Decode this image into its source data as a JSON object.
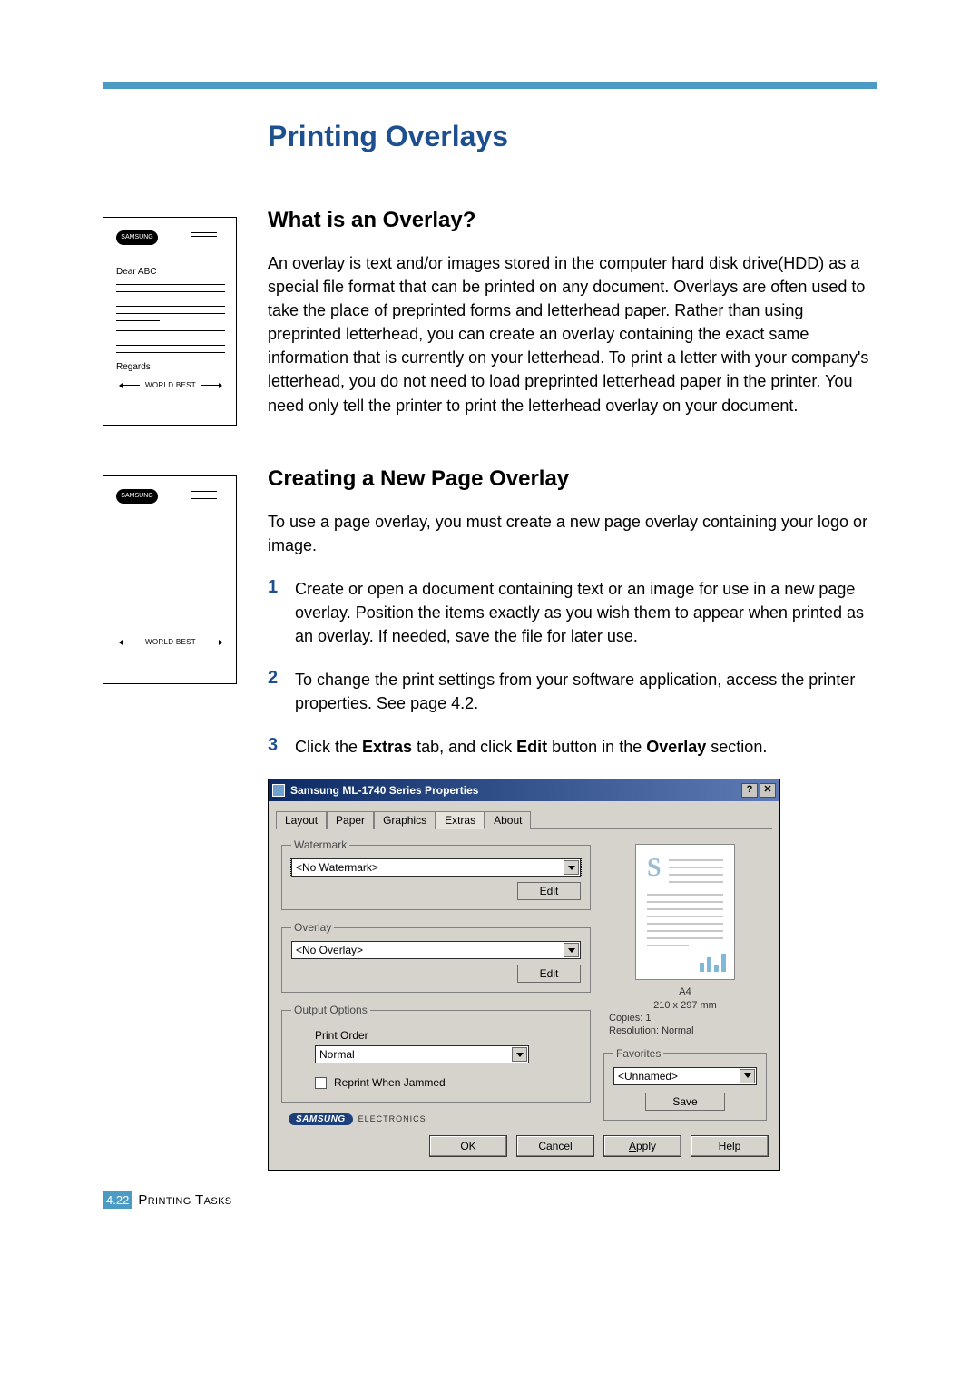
{
  "page_title": "Printing Overlays",
  "section1": {
    "heading": "What is an Overlay?",
    "text": "An overlay is text and/or images stored in the computer hard disk drive(HDD) as a special file format that can be printed on any document. Overlays are often used to take the place of preprinted forms and letterhead paper. Rather than using preprinted letterhead, you can create an overlay containing the exact same information that is currently on your letterhead. To print a letter with your company's letterhead, you do not need to load preprinted letterhead paper in the printer. You need only tell the printer to print the letterhead overlay on your document."
  },
  "section2": {
    "heading": "Creating a New Page Overlay",
    "intro": "To use a page overlay, you must create a new page overlay containing your logo or image.",
    "steps": [
      {
        "num": "1",
        "text": "Create or open a document containing text or an image for use in a new page overlay. Position the items exactly as you wish them to appear when printed as an overlay. If needed, save the file for later use."
      },
      {
        "num": "2",
        "text": "To change the print settings from your software application, access the printer properties. See page 4.2."
      },
      {
        "num": "3",
        "text_prefix": "Click the ",
        "b1": "Extras",
        "mid1": " tab, and click ",
        "b2": "Edit",
        "mid2": " button in the ",
        "b3": "Overlay",
        "suffix": " section."
      }
    ]
  },
  "letter": {
    "logo": "SAMSUNG",
    "salutation": "Dear ABC",
    "regards": "Regards",
    "world_best": "WORLD BEST"
  },
  "dialog": {
    "title": "Samsung ML-1740 Series Properties",
    "help_btn": "?",
    "close_btn": "✕",
    "tabs": [
      "Layout",
      "Paper",
      "Graphics",
      "Extras",
      "About"
    ],
    "active_tab": "Extras",
    "groups": {
      "watermark": {
        "legend": "Watermark",
        "value": "<No Watermark>",
        "edit": "Edit"
      },
      "overlay": {
        "legend": "Overlay",
        "value": "<No Overlay>",
        "edit": "Edit"
      },
      "output": {
        "legend": "Output Options",
        "print_order_label": "Print Order",
        "print_order_value": "Normal",
        "reprint": "Reprint When Jammed"
      },
      "favorites": {
        "legend": "Favorites",
        "value": "<Unnamed>",
        "save": "Save"
      }
    },
    "preview": {
      "paper_name": "A4",
      "paper_size": "210 x 297 mm",
      "copies": "Copies: 1",
      "resolution": "Resolution: Normal",
      "big_s": "S"
    },
    "brand": {
      "name": "SAMSUNG",
      "sub": "ELECTRONICS"
    },
    "buttons": {
      "ok": "OK",
      "cancel": "Cancel",
      "apply": "Apply",
      "help": "Help"
    }
  },
  "footer": {
    "page_num": "4.22",
    "chapter": "Printing Tasks"
  }
}
